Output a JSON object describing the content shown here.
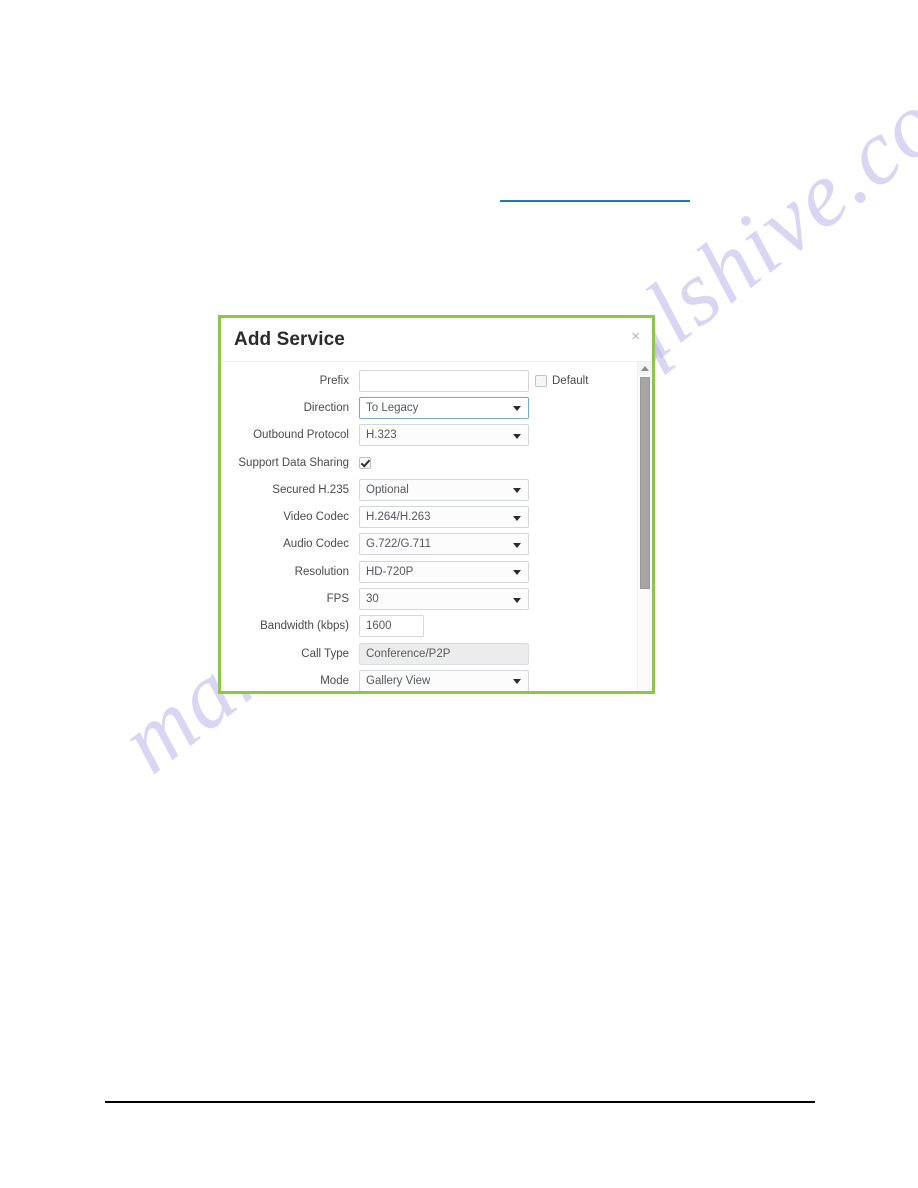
{
  "page": {
    "top_rule_color": "#1f7ea8",
    "footer_rule_color": "#000000",
    "watermark_text": "manualshive.com"
  },
  "dialog": {
    "title": "Add Service",
    "close_glyph": "×",
    "border_color": "#8ec64a",
    "fields": [
      {
        "label": "Prefix",
        "control": "text",
        "value": "",
        "extra_checkbox_label": "Default",
        "extra_checkbox_checked": false
      },
      {
        "label": "Direction",
        "control": "select",
        "value": "To Legacy",
        "focused": true
      },
      {
        "label": "Outbound Protocol",
        "control": "select",
        "value": "H.323"
      },
      {
        "label": "Support Data Sharing",
        "control": "checkbox",
        "checked": true
      },
      {
        "label": "Secured H.235",
        "control": "select",
        "value": "Optional"
      },
      {
        "label": "Video Codec",
        "control": "select",
        "value": "H.264/H.263"
      },
      {
        "label": "Audio Codec",
        "control": "select",
        "value": "G.722/G.711"
      },
      {
        "label": "Resolution",
        "control": "select",
        "value": "HD-720P"
      },
      {
        "label": "FPS",
        "control": "select",
        "value": "30"
      },
      {
        "label": "Bandwidth (kbps)",
        "control": "text",
        "value": "1600",
        "narrow": true
      },
      {
        "label": "Call Type",
        "control": "readonly",
        "value": "Conference/P2P"
      },
      {
        "label": "Mode",
        "control": "select",
        "value": "Gallery View"
      }
    ],
    "scrollbar": {
      "up_arrow": "scroll-up-arrow"
    }
  }
}
